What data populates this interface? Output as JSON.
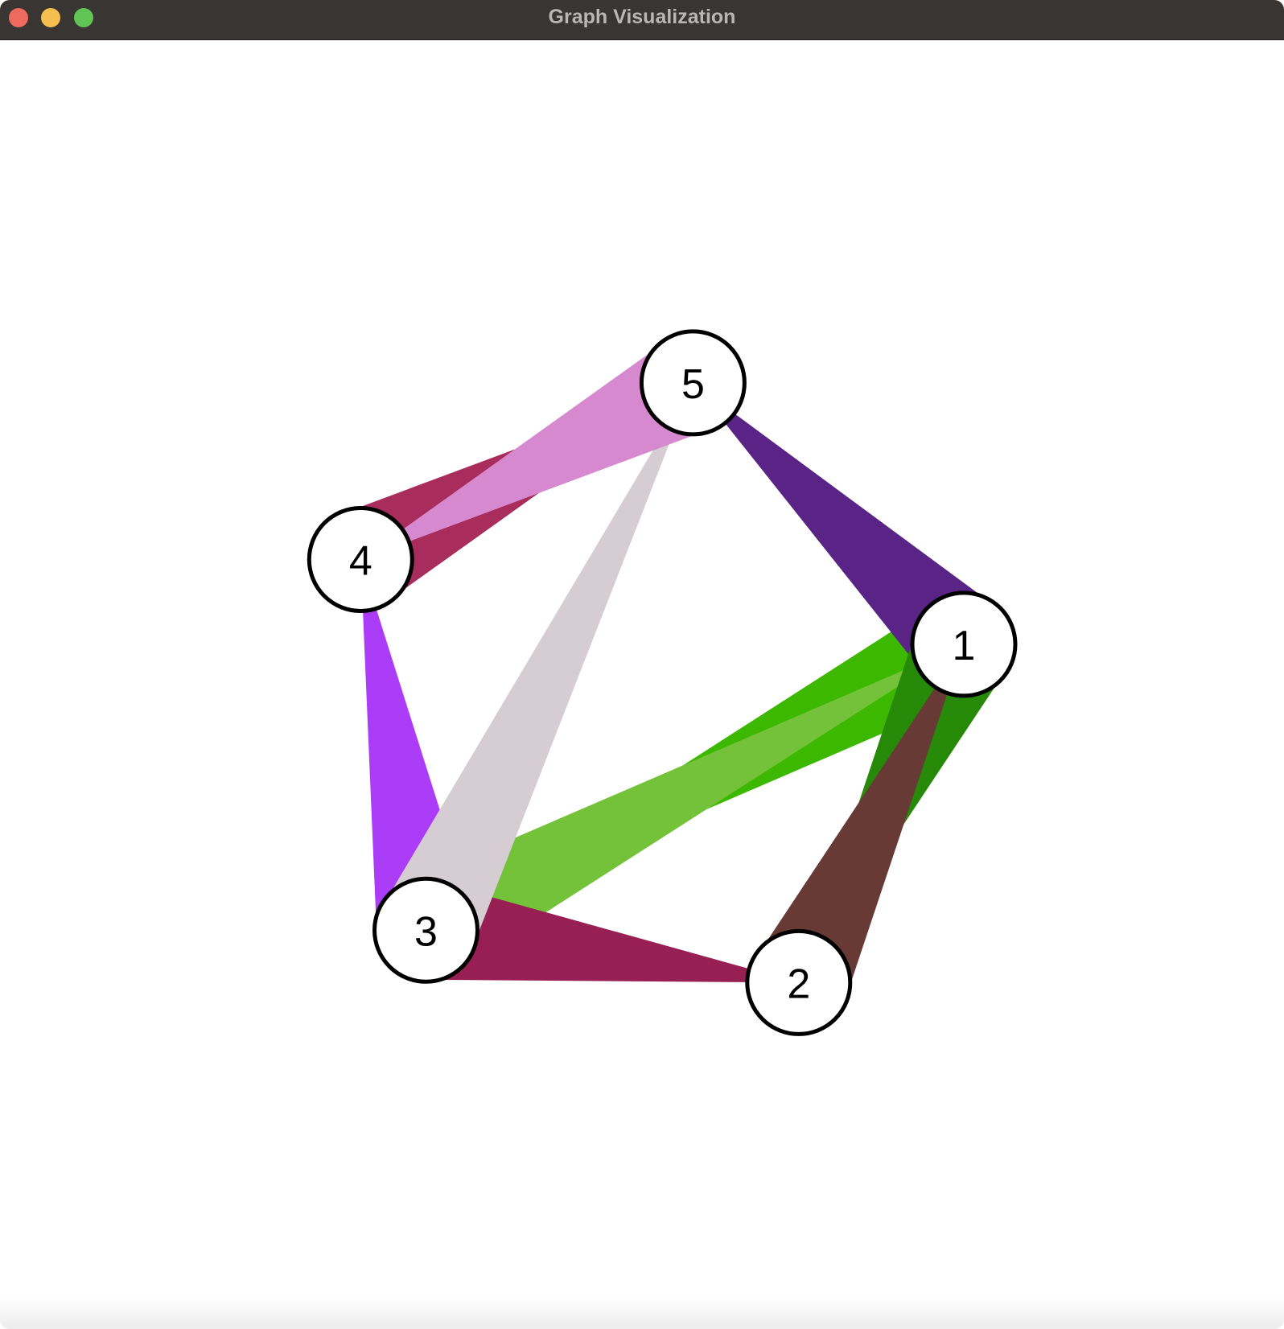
{
  "window": {
    "title": "Graph Visualization"
  },
  "graph": {
    "nodes": [
      {
        "id": "1",
        "label": "1"
      },
      {
        "id": "2",
        "label": "2"
      },
      {
        "id": "3",
        "label": "3"
      },
      {
        "id": "4",
        "label": "4"
      },
      {
        "id": "5",
        "label": "5"
      }
    ],
    "edges": [
      {
        "from": "1",
        "to": "3",
        "color": "#3db800"
      },
      {
        "from": "3",
        "to": "1",
        "color": "#73c23a"
      },
      {
        "from": "1",
        "to": "5",
        "color": "#5a2487"
      },
      {
        "from": "1",
        "to": "2",
        "color": "#268a08"
      },
      {
        "from": "2",
        "to": "1",
        "color": "#673a36"
      },
      {
        "from": "3",
        "to": "2",
        "color": "#981f53"
      },
      {
        "from": "3",
        "to": "4",
        "color": "#ab3cf7"
      },
      {
        "from": "3",
        "to": "5",
        "color": "#d5cdd2"
      },
      {
        "from": "4",
        "to": "5",
        "color": "#a92d5c"
      },
      {
        "from": "5",
        "to": "4",
        "color": "#d789cf"
      }
    ]
  }
}
